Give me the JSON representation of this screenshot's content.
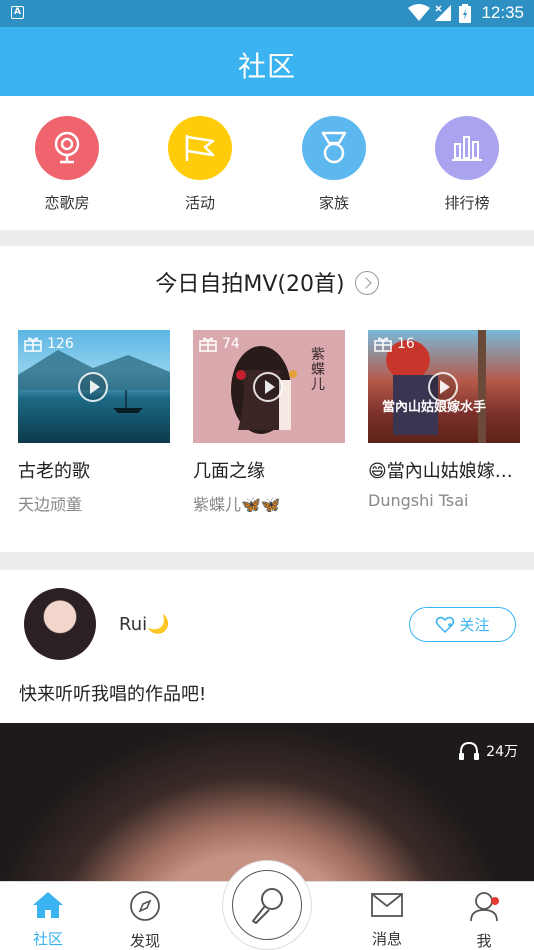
{
  "status_bar": {
    "time": "12:35",
    "app_icon": "A",
    "icons": [
      "wifi-icon",
      "signal-icon",
      "battery-icon"
    ]
  },
  "header": {
    "title": "社区"
  },
  "quick_links": [
    {
      "label": "恋歌房",
      "icon": "webcam-icon",
      "color": "#f0646e"
    },
    {
      "label": "活动",
      "icon": "flag-icon",
      "color": "#ffcc0a"
    },
    {
      "label": "家族",
      "icon": "medal-icon",
      "color": "#5db8f0"
    },
    {
      "label": "排行榜",
      "icon": "bar-chart-icon",
      "color": "#aaa4f0"
    }
  ],
  "mv_section": {
    "title": "今日自拍MV(20首)",
    "items": [
      {
        "gifts": "126",
        "title": "古老的歌",
        "artist": "天边顽童"
      },
      {
        "gifts": "74",
        "title": "几面之缘",
        "artist": "紫蝶儿🦋🦋",
        "thumb_text": "紫蝶儿"
      },
      {
        "gifts": "16",
        "title": "😄當內山姑娘嫁…",
        "artist": "Dungshi Tsai",
        "thumb_text": "當內山姑娘嫁水手"
      }
    ]
  },
  "post": {
    "username": "Rui🌙",
    "follow_label": "关注",
    "text": "快来听听我唱的作品吧!",
    "play_count": "24万"
  },
  "tab_bar": {
    "tabs": [
      {
        "label": "社区",
        "icon": "home-icon",
        "active": true
      },
      {
        "label": "发现",
        "icon": "compass-icon",
        "active": false
      },
      {
        "label": "消息",
        "icon": "mail-icon",
        "active": false
      },
      {
        "label": "我",
        "icon": "user-icon",
        "active": false
      }
    ],
    "center": "microphone-icon"
  },
  "colors": {
    "primary": "#3ab3f0",
    "status_bar": "#2e8fc2",
    "badge": "#e53935"
  }
}
